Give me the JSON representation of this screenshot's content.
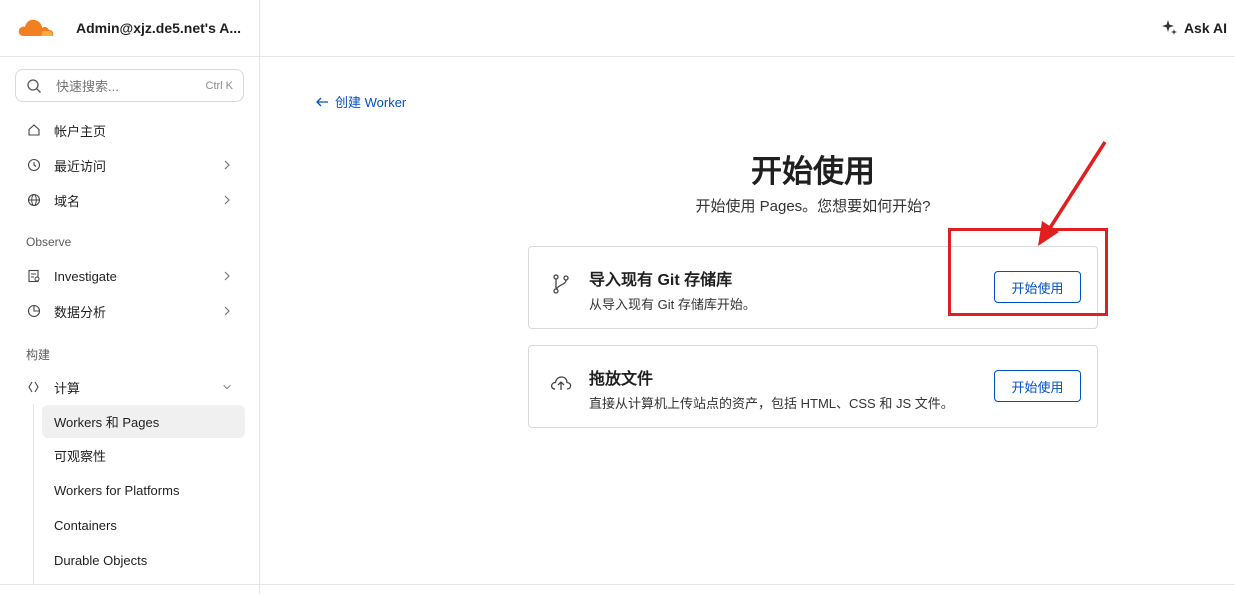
{
  "sidebar": {
    "account": "Admin@xjz.de5.net's A...",
    "search": {
      "placeholder": "快速搜索...",
      "shortcut": "Ctrl K"
    },
    "items": [
      {
        "label": "帐户主页",
        "icon": "home-icon"
      },
      {
        "label": "最近访问",
        "icon": "history-icon"
      },
      {
        "label": "域名",
        "icon": "globe-icon"
      }
    ],
    "observe": {
      "heading": "Observe",
      "items": [
        {
          "label": "Investigate",
          "icon": "investigate-icon"
        },
        {
          "label": "数据分析",
          "icon": "analytics-icon"
        }
      ]
    },
    "build": {
      "heading": "构建",
      "compute": {
        "label": "计算",
        "icon": "compute-icon"
      },
      "subitems": [
        {
          "label": "Workers 和 Pages",
          "active": true
        },
        {
          "label": "可观察性"
        },
        {
          "label": "Workers for Platforms"
        },
        {
          "label": "Containers"
        },
        {
          "label": "Durable Objects"
        }
      ]
    }
  },
  "topbar": {
    "ask_ai": "Ask AI"
  },
  "main": {
    "back_link": "创建 Worker",
    "title": "开始使用",
    "subtitle": "开始使用 Pages。您想要如何开始?",
    "cards": [
      {
        "title": "导入现有 Git 存储库",
        "desc": "从导入现有 Git 存储库开始。",
        "button": "开始使用",
        "icon": "git-branch-icon"
      },
      {
        "title": "拖放文件",
        "desc": "直接从计算机上传站点的资产，包括 HTML、CSS 和 JS 文件。",
        "button": "开始使用",
        "icon": "cloud-upload-icon"
      }
    ]
  },
  "colors": {
    "accent": "#0051c3",
    "highlight": "#e02020",
    "brand": "#f38020"
  }
}
